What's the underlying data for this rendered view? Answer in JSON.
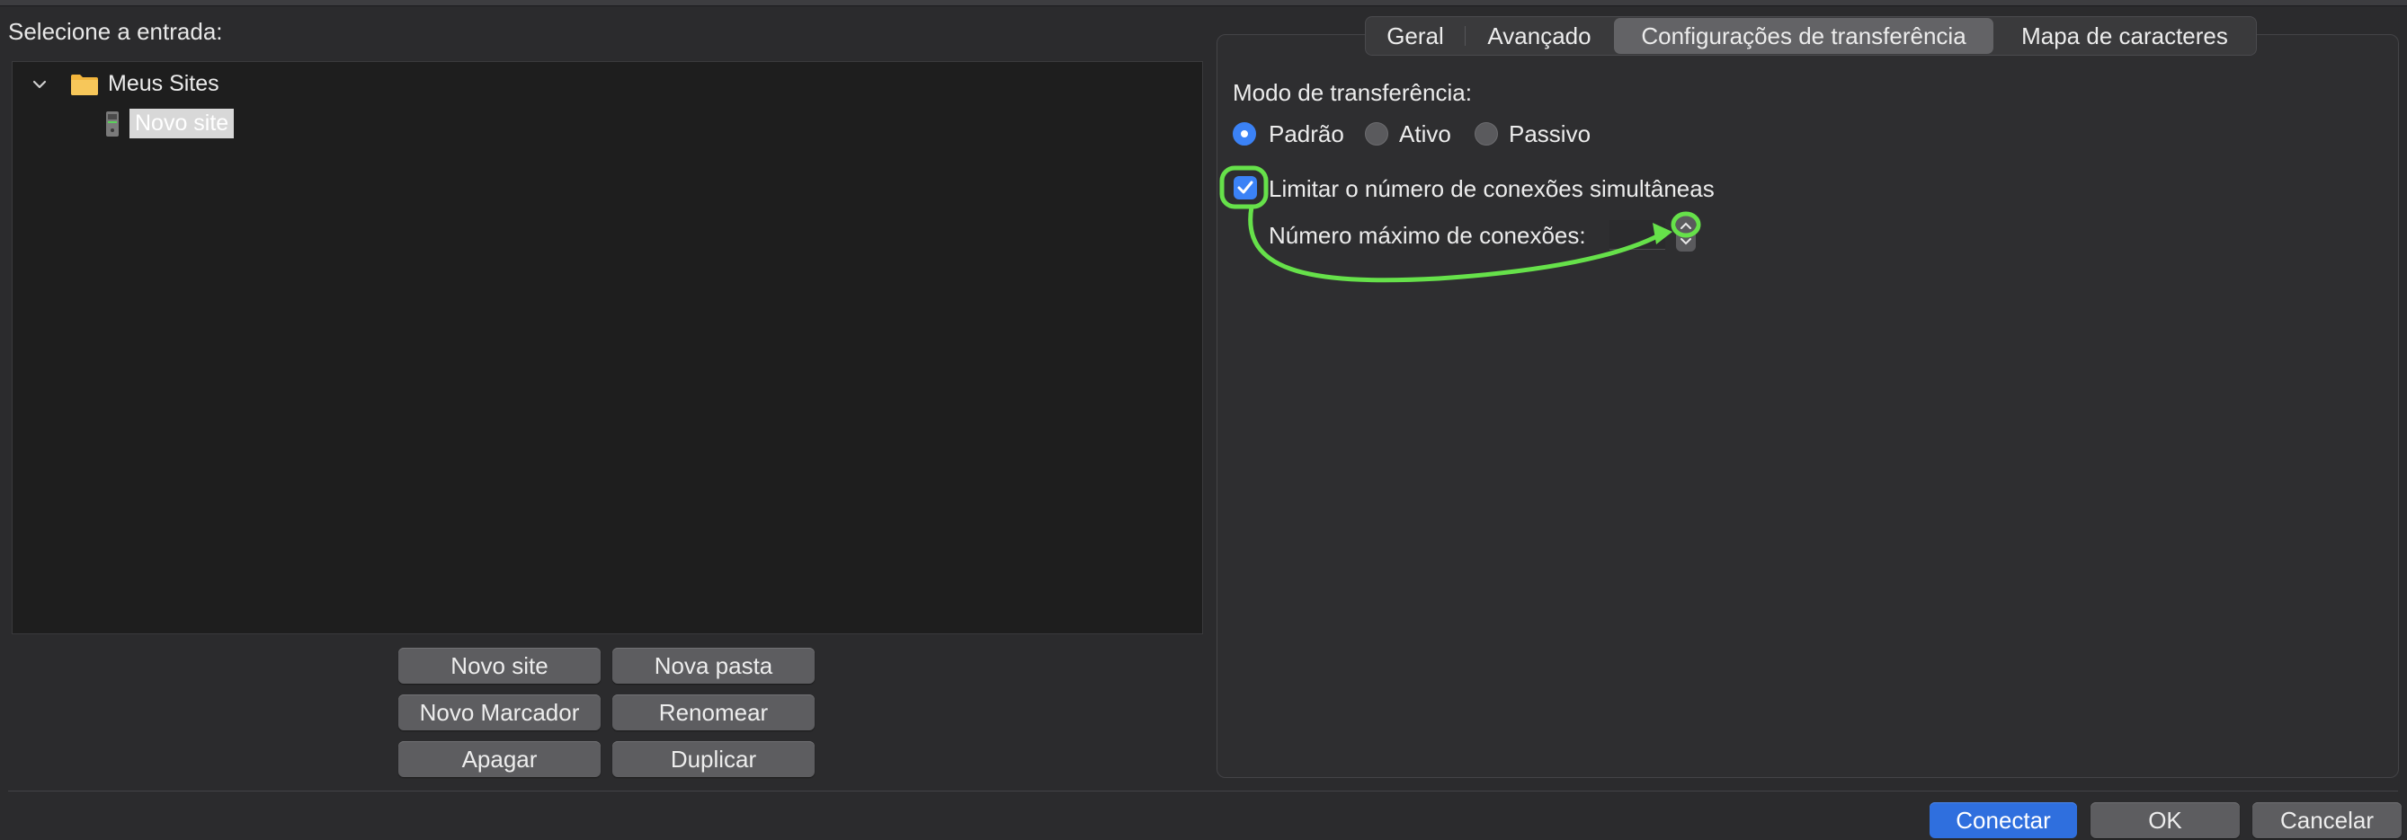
{
  "left": {
    "select_label": "Selecione a entrada:",
    "tree": {
      "root": {
        "label": "Meus Sites",
        "icon": "folder-icon",
        "expanded": true
      },
      "child": {
        "label": "Novo site",
        "icon": "server-icon",
        "selected": true
      }
    },
    "buttons": {
      "new_site": "Novo site",
      "new_folder": "Nova pasta",
      "new_bookmark": "Novo Marcador",
      "rename": "Renomear",
      "delete": "Apagar",
      "duplicate": "Duplicar"
    }
  },
  "tabs": [
    {
      "label": "Geral",
      "active": false
    },
    {
      "label": "Avançado",
      "active": false
    },
    {
      "label": "Configurações de transferência",
      "active": true
    },
    {
      "label": "Mapa de caracteres",
      "active": false
    }
  ],
  "transfer": {
    "mode_label": "Modo de transferência:",
    "modes": [
      {
        "label": "Padrão",
        "selected": true
      },
      {
        "label": "Ativo",
        "selected": false
      },
      {
        "label": "Passivo",
        "selected": false
      }
    ],
    "limit_checkbox_label": "Limitar o número de conexões simultâneas",
    "limit_checked": true,
    "max_connections_label": "Número máximo de conexões:",
    "max_connections_value": ""
  },
  "footer": {
    "connect": "Conectar",
    "ok": "OK",
    "cancel": "Cancelar"
  },
  "colors": {
    "accent": "#3b82f6",
    "annotation": "#66e14a"
  }
}
